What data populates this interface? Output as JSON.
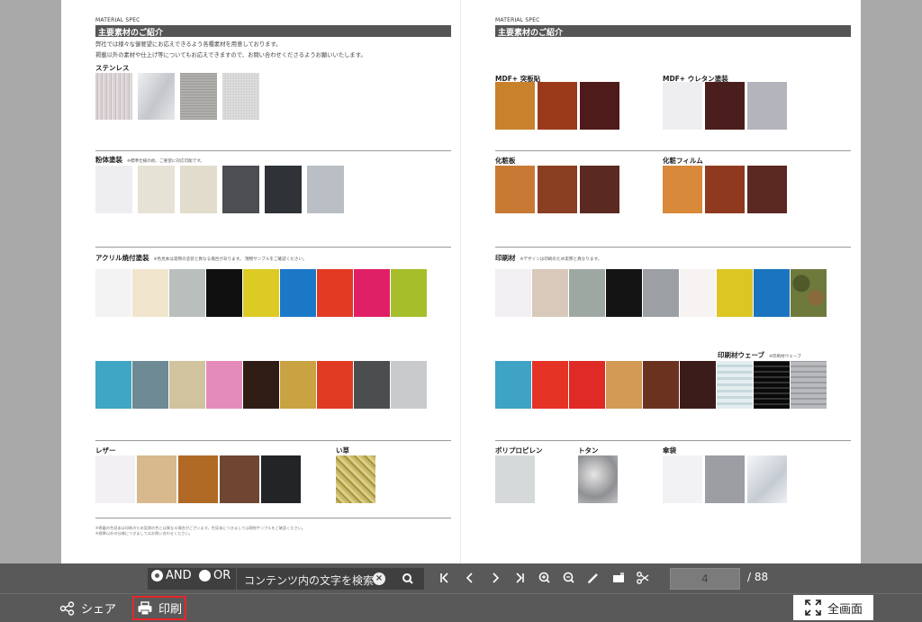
{
  "left_page": {
    "spec_label": "MATERIAL SPEC",
    "title": "主要素材のご紹介",
    "intro_lines": [
      "弊社では様々な御要望にお応えできるよう各種素材を用意しております。",
      "掲載以外の素材や仕上げ等についてもお応えできますので、お問い合わせくださるようお願いいたします。"
    ],
    "sections": {
      "stainless": {
        "title": "ステンレス",
        "note": ""
      },
      "powder": {
        "title": "粉体塗装",
        "note": "※標準仕様の他、ご要望に対応可能です。"
      },
      "acrylic": {
        "title": "アクリル焼付塗装",
        "note": "※色見本は実際の塗装と異なる場合があります。 現物サンプルをご確認ください。"
      },
      "leather": {
        "title": "レザー",
        "note": ""
      },
      "rush": {
        "title": "い草",
        "note": ""
      }
    },
    "footnote_lines": [
      "※掲載の色見本は印刷のため実際の色とは異なる場合がございます。色見本につきましては現物サンプルをご確認ください。",
      "※標準以外の仕様につきましてはお問い合わせください。"
    ]
  },
  "right_page": {
    "spec_label": "MATERIAL SPEC",
    "title": "主要素材のご紹介",
    "sections": {
      "mdf_veneer": {
        "title": "MDF+ 突板貼",
        "note": ""
      },
      "mdf_urethane": {
        "title": "MDF+ ウレタン塗装",
        "note": ""
      },
      "decor_board": {
        "title": "化粧板",
        "note": ""
      },
      "decor_film": {
        "title": "化粧フィルム",
        "note": ""
      },
      "print_material": {
        "title": "印刷材",
        "note": "※デザインは印刷のため実際と異なります。"
      },
      "print_wave": {
        "title": "印刷材ウェーブ",
        "note": "※印刷材ウェーブ"
      },
      "pp": {
        "title": "ポリプロピレン",
        "note": ""
      },
      "tin": {
        "title": "トタン",
        "note": ""
      },
      "cloth": {
        "title": "傘袋",
        "note": ""
      }
    }
  },
  "toolbar": {
    "and_label": "AND",
    "or_label": "OR",
    "search_placeholder": "コンテンツ内の文字を検索",
    "current_page": "4",
    "total_pages": "/ 88"
  },
  "bottom": {
    "share_label": "シェア",
    "print_label": "印刷",
    "fullscreen_label": "全画面"
  },
  "colors": {
    "toolbar_bg": "#595959",
    "print_highlight": "#e8262a",
    "title_bar": "#555555"
  }
}
